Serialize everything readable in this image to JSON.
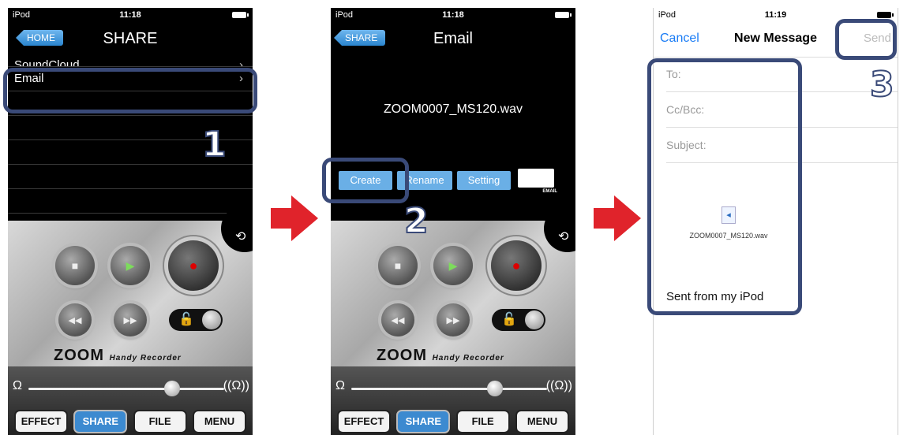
{
  "colors": {
    "accent_blue": "#3c8ad0",
    "callout": "#3a4a78",
    "arrow": "#e0232b",
    "ios_blue": "#1a7cf5"
  },
  "steps": [
    "1",
    "2",
    "3"
  ],
  "phone1": {
    "status": {
      "carrier": "iPod",
      "time": "11:18"
    },
    "back_label": "HOME",
    "title": "SHARE",
    "rows": [
      {
        "label": "SoundCloud"
      },
      {
        "label": "Email"
      }
    ],
    "brand": "ZOOM",
    "brand_sub": "Handy Recorder",
    "tabs": [
      "EFFECT",
      "SHARE",
      "FILE",
      "MENU"
    ]
  },
  "phone2": {
    "status": {
      "carrier": "iPod",
      "time": "11:18"
    },
    "back_label": "SHARE",
    "title": "Email",
    "filename": "ZOOM0007_MS120.wav",
    "buttons": [
      "Create",
      "Rename",
      "Setting"
    ],
    "email_icon_label": "EMAIL",
    "brand": "ZOOM",
    "brand_sub": "Handy Recorder",
    "tabs": [
      "EFFECT",
      "SHARE",
      "FILE",
      "MENU"
    ]
  },
  "phone3": {
    "status": {
      "carrier": "iPod",
      "time": "11:19"
    },
    "cancel": "Cancel",
    "title": "New Message",
    "send": "Send",
    "fields": [
      "To:",
      "Cc/Bcc:",
      "Subject:"
    ],
    "attachment": "ZOOM0007_MS120.wav",
    "signature": "Sent from my iPod"
  }
}
